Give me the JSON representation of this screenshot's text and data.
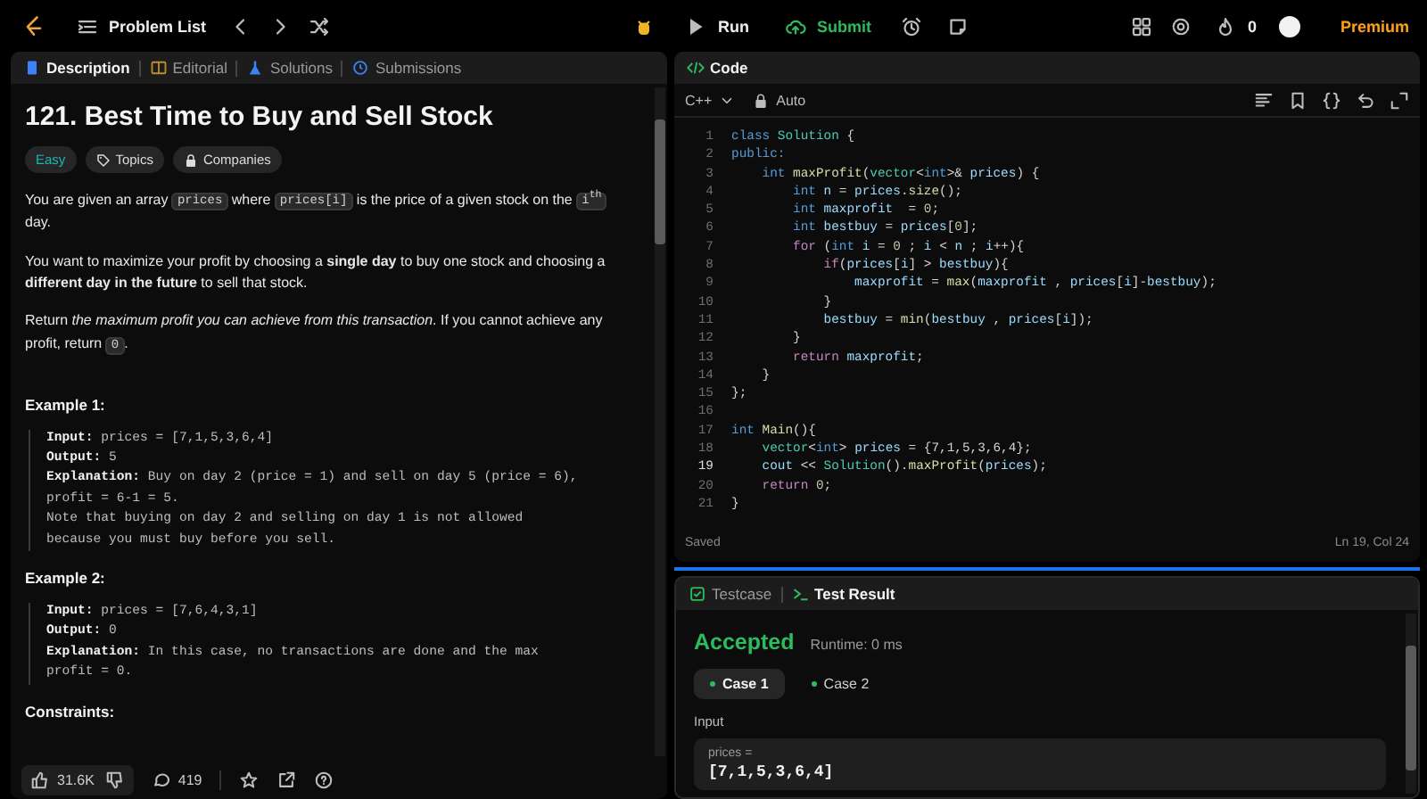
{
  "top_bar": {
    "problem_list": "Problem List",
    "run": "Run",
    "submit": "Submit",
    "streak": "0",
    "premium": "Premium"
  },
  "description_panel": {
    "tabs": [
      {
        "label": "Description",
        "kind": "description",
        "selected": true
      },
      {
        "label": "Editorial",
        "kind": "editorial",
        "selected": false
      },
      {
        "label": "Solutions",
        "kind": "solutions",
        "selected": false
      },
      {
        "label": "Submissions",
        "kind": "submissions",
        "selected": false
      }
    ],
    "title": "121. Best Time to Buy and Sell Stock",
    "tags": [
      {
        "label": "Easy",
        "kind": "difficulty"
      },
      {
        "label": "Topics",
        "kind": "topics"
      },
      {
        "label": "Companies",
        "kind": "companies"
      }
    ],
    "paragraphs": [
      [
        {
          "kind": "text",
          "text": "You are given an array "
        },
        {
          "kind": "code",
          "text": "prices"
        },
        {
          "kind": "text",
          "text": " where "
        },
        {
          "kind": "code",
          "text": "prices[i]"
        },
        {
          "kind": "text",
          "text": " is the price of a given stock on the "
        },
        {
          "kind": "code",
          "text": "i$^{th}$"
        },
        {
          "kind": "text",
          "text": " day."
        }
      ],
      [
        {
          "kind": "text",
          "text": "You want to maximize your profit by choosing a **single day** to buy one stock and choosing a **different day in the future** to sell that stock."
        }
      ],
      [
        {
          "kind": "text",
          "text": "Return *the maximum profit you can achieve from this transaction*. If you cannot achieve any profit, return "
        },
        {
          "kind": "code",
          "text": "0"
        },
        {
          "kind": "text",
          "text": "."
        }
      ]
    ],
    "examples": [
      {
        "heading": "Example 1:",
        "lines": [
          "**Input:** prices = [7,1,5,3,6,4]",
          "**Output:** 5",
          "**Explanation:** Buy on day 2 (price = 1) and sell on day 5 (price = 6),",
          "profit = 6-1 = 5.",
          "Note that buying on day 2 and selling on day 1 is not allowed",
          "because you must buy before you sell."
        ]
      },
      {
        "heading": "Example 2:",
        "lines": [
          "**Input:** prices = [7,6,4,3,1]",
          "**Output:** 0",
          "**Explanation:** In this case, no transactions are done and the max",
          "profit = 0."
        ]
      }
    ],
    "constraints_heading": "Constraints:",
    "toolbar": {
      "likes": "31.6K",
      "comments": "419"
    }
  },
  "code_panel": {
    "title": "Code",
    "language": "C++",
    "mode": "Auto",
    "lines": [
      {
        "number": "1",
        "current": false,
        "tokens": [
          {
            "kind": "kw",
            "text": "class "
          },
          {
            "kind": "ty",
            "text": "Solution"
          },
          {
            "kind": "pl",
            "text": " {"
          }
        ]
      },
      {
        "number": "2",
        "current": false,
        "tokens": [
          {
            "kind": "kw",
            "text": "public:"
          }
        ]
      },
      {
        "number": "3",
        "current": false,
        "tokens": [
          {
            "kind": "kw",
            "text": "    int "
          },
          {
            "kind": "fn",
            "text": "maxProfit"
          },
          {
            "kind": "pl",
            "text": "("
          },
          {
            "kind": "ty",
            "text": "vector"
          },
          {
            "kind": "pl",
            "text": "<"
          },
          {
            "kind": "kw",
            "text": "int"
          },
          {
            "kind": "pl",
            "text": ">& "
          },
          {
            "kind": "var",
            "text": "prices"
          },
          {
            "kind": "pl",
            "text": ") {"
          }
        ]
      },
      {
        "number": "4",
        "current": false,
        "tokens": [
          {
            "kind": "kw",
            "text": "        int "
          },
          {
            "kind": "var",
            "text": "n"
          },
          {
            "kind": "pl",
            "text": " = "
          },
          {
            "kind": "var",
            "text": "prices"
          },
          {
            "kind": "pl",
            "text": "."
          },
          {
            "kind": "fn",
            "text": "size"
          },
          {
            "kind": "pl",
            "text": "();"
          }
        ]
      },
      {
        "number": "5",
        "current": false,
        "tokens": [
          {
            "kind": "kw",
            "text": "        int "
          },
          {
            "kind": "var",
            "text": "maxprofit"
          },
          {
            "kind": "pl",
            "text": "  = "
          },
          {
            "kind": "num",
            "text": "0"
          },
          {
            "kind": "pl",
            "text": ";"
          }
        ]
      },
      {
        "number": "6",
        "current": false,
        "tokens": [
          {
            "kind": "kw",
            "text": "        int "
          },
          {
            "kind": "var",
            "text": "bestbuy"
          },
          {
            "kind": "pl",
            "text": " = "
          },
          {
            "kind": "var",
            "text": "prices"
          },
          {
            "kind": "pl",
            "text": "["
          },
          {
            "kind": "num",
            "text": "0"
          },
          {
            "kind": "pl",
            "text": "];"
          }
        ]
      },
      {
        "number": "7",
        "current": false,
        "tokens": [
          {
            "kind": "ctrl",
            "text": "        for"
          },
          {
            "kind": "pl",
            "text": " ("
          },
          {
            "kind": "kw",
            "text": "int "
          },
          {
            "kind": "var",
            "text": "i"
          },
          {
            "kind": "pl",
            "text": " = "
          },
          {
            "kind": "num",
            "text": "0"
          },
          {
            "kind": "pl",
            "text": " ; "
          },
          {
            "kind": "var",
            "text": "i"
          },
          {
            "kind": "pl",
            "text": " < "
          },
          {
            "kind": "var",
            "text": "n"
          },
          {
            "kind": "pl",
            "text": " ; "
          },
          {
            "kind": "var",
            "text": "i"
          },
          {
            "kind": "pl",
            "text": "++){"
          }
        ]
      },
      {
        "number": "8",
        "current": false,
        "tokens": [
          {
            "kind": "ctrl",
            "text": "            if"
          },
          {
            "kind": "pl",
            "text": "("
          },
          {
            "kind": "var",
            "text": "prices"
          },
          {
            "kind": "pl",
            "text": "["
          },
          {
            "kind": "var",
            "text": "i"
          },
          {
            "kind": "pl",
            "text": "] > "
          },
          {
            "kind": "var",
            "text": "bestbuy"
          },
          {
            "kind": "pl",
            "text": "){"
          }
        ]
      },
      {
        "number": "9",
        "current": false,
        "tokens": [
          {
            "kind": "var",
            "text": "                maxprofit"
          },
          {
            "kind": "pl",
            "text": " = "
          },
          {
            "kind": "fn",
            "text": "max"
          },
          {
            "kind": "pl",
            "text": "("
          },
          {
            "kind": "var",
            "text": "maxprofit"
          },
          {
            "kind": "pl",
            "text": " , "
          },
          {
            "kind": "var",
            "text": "prices"
          },
          {
            "kind": "pl",
            "text": "["
          },
          {
            "kind": "var",
            "text": "i"
          },
          {
            "kind": "pl",
            "text": "]-"
          },
          {
            "kind": "var",
            "text": "bestbuy"
          },
          {
            "kind": "pl",
            "text": ");"
          }
        ]
      },
      {
        "number": "10",
        "current": false,
        "tokens": [
          {
            "kind": "pl",
            "text": "            }"
          }
        ]
      },
      {
        "number": "11",
        "current": false,
        "tokens": [
          {
            "kind": "var",
            "text": "            bestbuy"
          },
          {
            "kind": "pl",
            "text": " = "
          },
          {
            "kind": "fn",
            "text": "min"
          },
          {
            "kind": "pl",
            "text": "("
          },
          {
            "kind": "var",
            "text": "bestbuy"
          },
          {
            "kind": "pl",
            "text": " , "
          },
          {
            "kind": "var",
            "text": "prices"
          },
          {
            "kind": "pl",
            "text": "["
          },
          {
            "kind": "var",
            "text": "i"
          },
          {
            "kind": "pl",
            "text": "]);"
          }
        ]
      },
      {
        "number": "12",
        "current": false,
        "tokens": [
          {
            "kind": "pl",
            "text": "        }"
          }
        ]
      },
      {
        "number": "13",
        "current": false,
        "tokens": [
          {
            "kind": "ctrl",
            "text": "        return "
          },
          {
            "kind": "var",
            "text": "maxprofit"
          },
          {
            "kind": "pl",
            "text": ";"
          }
        ]
      },
      {
        "number": "14",
        "current": false,
        "tokens": [
          {
            "kind": "pl",
            "text": "    }"
          }
        ]
      },
      {
        "number": "15",
        "current": false,
        "tokens": [
          {
            "kind": "pl",
            "text": "};"
          }
        ]
      },
      {
        "number": "16",
        "current": false
      },
      {
        "number": "17",
        "current": false,
        "tokens": [
          {
            "kind": "kw",
            "text": "int "
          },
          {
            "kind": "fn",
            "text": "Main"
          },
          {
            "kind": "pl",
            "text": "(){"
          }
        ]
      },
      {
        "number": "18",
        "current": false,
        "tokens": [
          {
            "kind": "ty",
            "text": "    vector"
          },
          {
            "kind": "pl",
            "text": "<"
          },
          {
            "kind": "kw",
            "text": "int"
          },
          {
            "kind": "pl",
            "text": "> "
          },
          {
            "kind": "var",
            "text": "prices"
          },
          {
            "kind": "pl",
            "text": " = {7,1,5,3,6,4};"
          }
        ]
      },
      {
        "number": "19",
        "current": true,
        "tokens": [
          {
            "kind": "var",
            "text": "    cout"
          },
          {
            "kind": "pl",
            "text": " << "
          },
          {
            "kind": "ty",
            "text": "Solution"
          },
          {
            "kind": "pl",
            "text": "()."
          },
          {
            "kind": "fn",
            "text": "maxProfit"
          },
          {
            "kind": "pl",
            "text": "("
          },
          {
            "kind": "var",
            "text": "prices"
          },
          {
            "kind": "pl",
            "text": ");"
          }
        ]
      },
      {
        "number": "20",
        "current": false,
        "tokens": [
          {
            "kind": "ctrl",
            "text": "    return "
          },
          {
            "kind": "num",
            "text": "0"
          },
          {
            "kind": "pl",
            "text": ";"
          }
        ]
      },
      {
        "number": "21",
        "current": false,
        "tokens": [
          {
            "kind": "pl",
            "text": "}"
          }
        ]
      }
    ],
    "status": "Saved",
    "cursor": "Ln 19, Col 24"
  },
  "result_panel": {
    "tabs": [
      {
        "label": "Testcase",
        "kind": "testcase",
        "selected": false
      },
      {
        "label": "Test Result",
        "kind": "result",
        "selected": true
      }
    ],
    "verdict": "Accepted",
    "runtime": "Runtime: 0 ms",
    "cases": [
      {
        "label": "Case 1",
        "selected": true
      },
      {
        "label": "Case 2",
        "selected": false
      }
    ],
    "input_label": "Input",
    "inputs": [
      {
        "name": "prices =",
        "value": "[7,1,5,3,6,4]"
      }
    ]
  }
}
